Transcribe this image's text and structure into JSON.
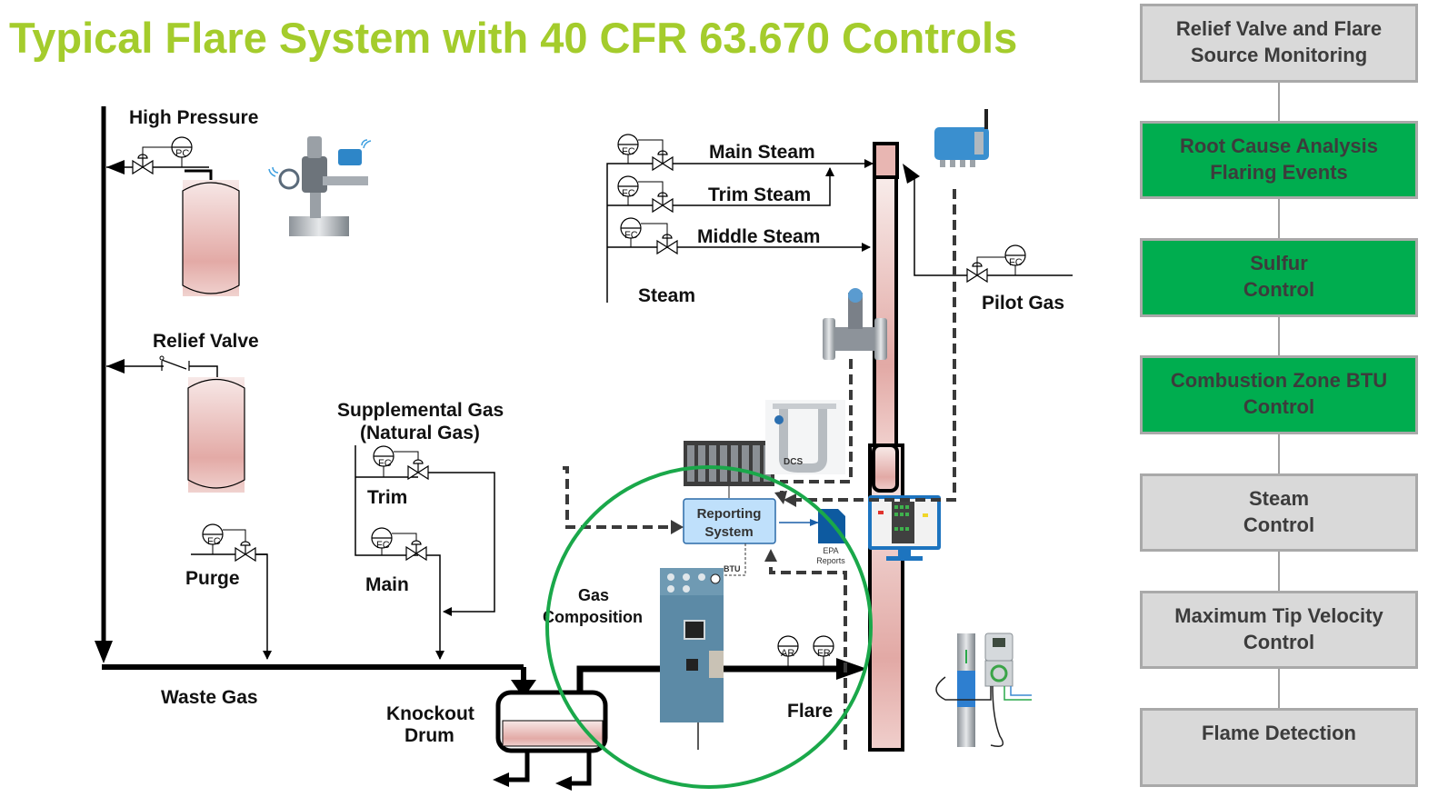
{
  "title": "Typical Flare System with 40 CFR 63.670 Controls",
  "colors": {
    "title": "#a4cc2c",
    "active_box": "#00ad4f",
    "inactive_box": "#d9d9d9",
    "box_border": "#a9a9a9",
    "box_text": "#3c3c3c",
    "highlight_circle": "#1aa84a",
    "vessel_fill": "#e3aaa6",
    "reporting_box": "#bfe0fb"
  },
  "sources": {
    "high_pressure": "High Pressure",
    "relief_valve": "Relief Valve",
    "purge": "Purge",
    "supplemental_gas_line1": "Supplemental Gas",
    "supplemental_gas_line2": "(Natural Gas)",
    "trim": "Trim",
    "main": "Main",
    "waste_gas": "Waste Gas",
    "knockout_line1": "Knockout",
    "knockout_line2": "Drum",
    "gas_composition_line1": "Gas",
    "gas_composition_line2": "Composition",
    "flare": "Flare"
  },
  "steam": {
    "main_steam": "Main Steam",
    "trim_steam": "Trim Steam",
    "middle_steam": "Middle Steam",
    "steam": "Steam",
    "pilot_gas": "Pilot Gas"
  },
  "instrument_tags": {
    "pc": "PC",
    "fc": "FC",
    "ar": "AR",
    "fr": "FR"
  },
  "controls": {
    "dcs": "DCS",
    "reporting_line1": "Reporting",
    "reporting_line2": "System",
    "epa_line1": "EPA",
    "epa_line2": "Reports",
    "btu": "BTU"
  },
  "sidebar": [
    {
      "line1": "Relief Valve and Flare",
      "line2": "Source Monitoring",
      "active": false
    },
    {
      "line1": "Root Cause Analysis",
      "line2": "Flaring Events",
      "active": true
    },
    {
      "line1": "Sulfur",
      "line2": "Control",
      "active": true
    },
    {
      "line1": "Combustion Zone BTU",
      "line2": "Control",
      "active": true
    },
    {
      "line1": "Steam",
      "line2": "Control",
      "active": false
    },
    {
      "line1": "Maximum Tip Velocity",
      "line2": "Control",
      "active": false
    },
    {
      "line1": "Flame Detection",
      "line2": "",
      "active": false
    }
  ]
}
